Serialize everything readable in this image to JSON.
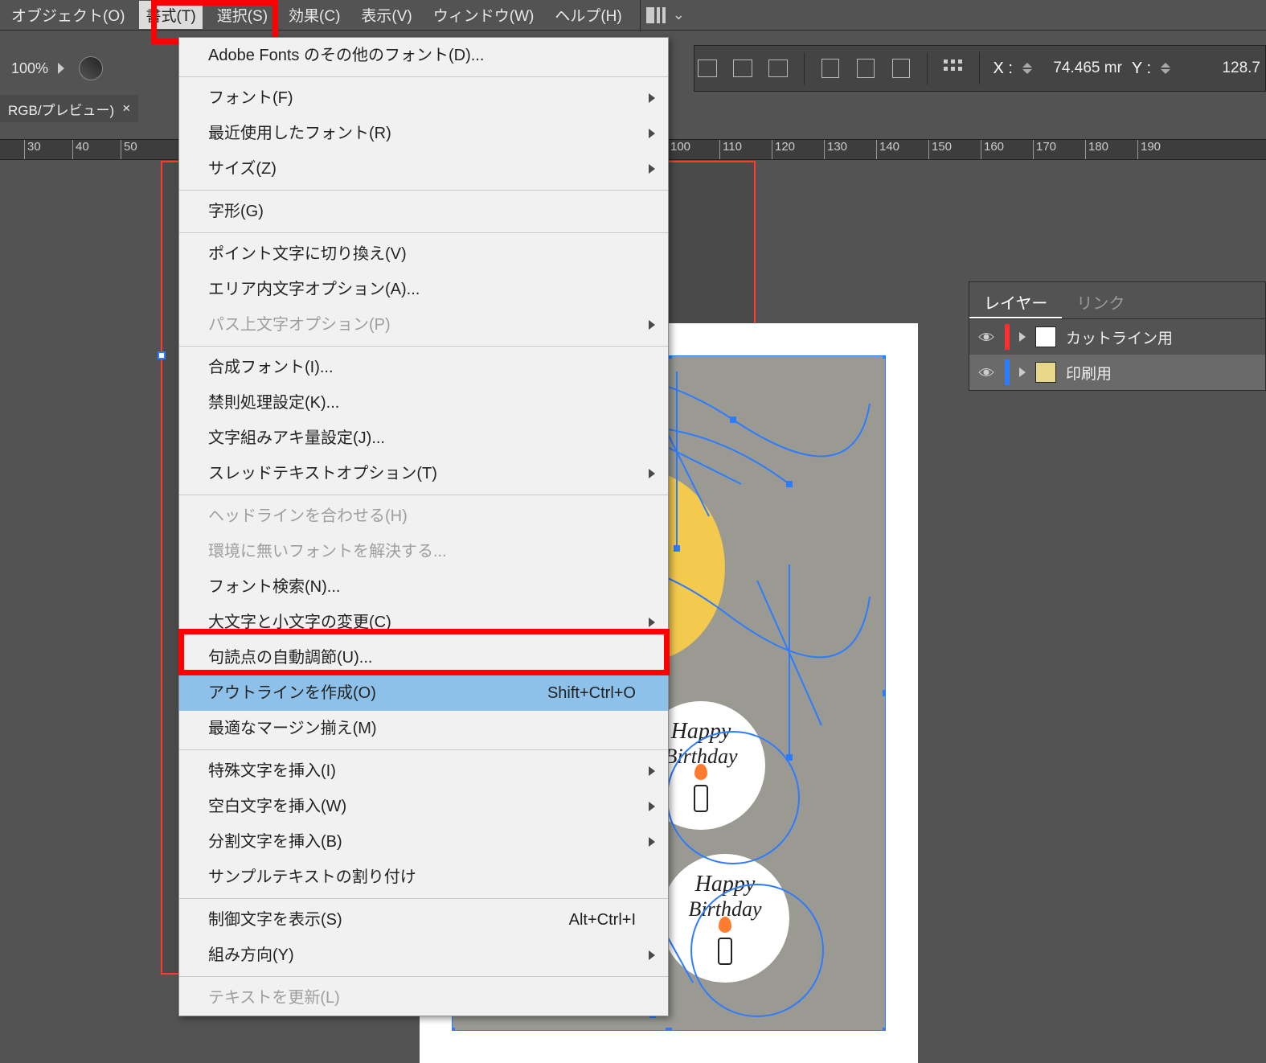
{
  "menubar": {
    "items": [
      "オブジェクト(O)",
      "書式(T)",
      "選択(S)",
      "効果(C)",
      "表示(V)",
      "ウィンドウ(W)",
      "ヘルプ(H)"
    ],
    "active_index": 1
  },
  "zoom": {
    "value": "100%"
  },
  "coords": {
    "x_label": "X :",
    "x_value": "74.465 mr",
    "y_label": "Y :",
    "y_value": "128.7"
  },
  "doc_tab": {
    "label": "RGB/プレビュー)",
    "close": "×"
  },
  "ruler_ticks": [
    30,
    40,
    50,
    100,
    110,
    120,
    130,
    140,
    150,
    160,
    170,
    180,
    190
  ],
  "dropdown": {
    "groups": [
      [
        {
          "label": "Adobe Fonts のその他のフォント(D)...",
          "disabled": false
        }
      ],
      [
        {
          "label": "フォント(F)",
          "submenu": true
        },
        {
          "label": "最近使用したフォント(R)",
          "submenu": true
        },
        {
          "label": "サイズ(Z)",
          "submenu": true
        }
      ],
      [
        {
          "label": "字形(G)"
        }
      ],
      [
        {
          "label": "ポイント文字に切り換え(V)"
        },
        {
          "label": "エリア内文字オプション(A)..."
        },
        {
          "label": "パス上文字オプション(P)",
          "submenu": true,
          "disabled": true
        }
      ],
      [
        {
          "label": "合成フォント(I)..."
        },
        {
          "label": "禁則処理設定(K)..."
        },
        {
          "label": "文字組みアキ量設定(J)..."
        },
        {
          "label": "スレッドテキストオプション(T)",
          "submenu": true
        }
      ],
      [
        {
          "label": "ヘッドラインを合わせる(H)",
          "disabled": true
        },
        {
          "label": "環境に無いフォントを解決する...",
          "disabled": true
        },
        {
          "label": "フォント検索(N)..."
        },
        {
          "label": "大文字と小文字の変更(C)",
          "submenu": true
        },
        {
          "label": "句読点の自動調節(U)..."
        },
        {
          "label": "アウトラインを作成(O)",
          "shortcut": "Shift+Ctrl+O",
          "selected": true
        },
        {
          "label": "最適なマージン揃え(M)"
        }
      ],
      [
        {
          "label": "特殊文字を挿入(I)",
          "submenu": true
        },
        {
          "label": "空白文字を挿入(W)",
          "submenu": true
        },
        {
          "label": "分割文字を挿入(B)",
          "submenu": true
        },
        {
          "label": "サンプルテキストの割り付け"
        }
      ],
      [
        {
          "label": "制御文字を表示(S)",
          "shortcut": "Alt+Ctrl+I"
        },
        {
          "label": "組み方向(Y)",
          "submenu": true
        }
      ],
      [
        {
          "label": "テキストを更新(L)",
          "disabled": true
        }
      ]
    ]
  },
  "layers": {
    "tabs": [
      "レイヤー",
      "リンク"
    ],
    "active_tab": 0,
    "rows": [
      {
        "color": "#ff2d2d",
        "name": "カットライン用",
        "thumb": "blank"
      },
      {
        "color": "#2d7bff",
        "name": "印刷用",
        "thumb": "img",
        "active": true
      }
    ]
  },
  "artwork": {
    "badge_line1": "Happy",
    "badge_line2": "Birthday"
  }
}
